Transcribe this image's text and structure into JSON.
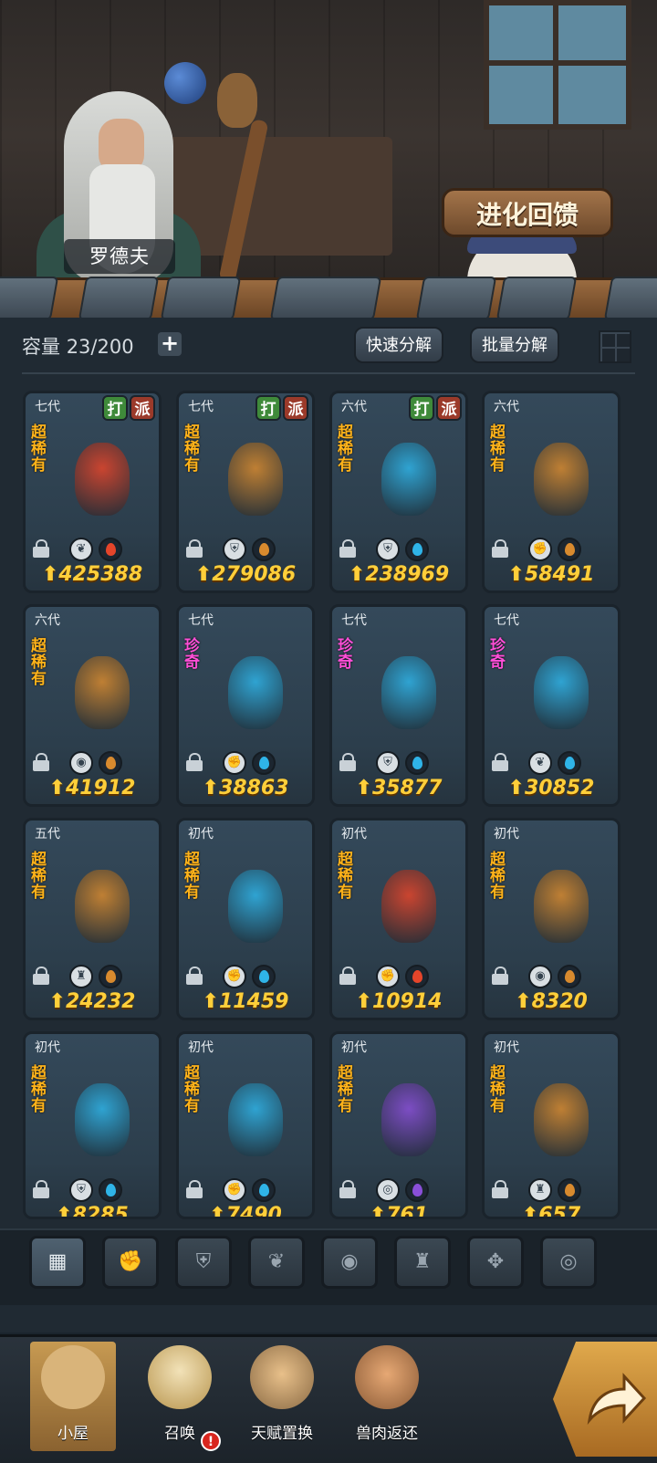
{
  "npc": {
    "name": "罗德夫"
  },
  "header": {
    "evolve_feedback": "进化回馈"
  },
  "toolbar": {
    "capacity_label": "容量",
    "capacity_value": "23/200",
    "plus": "+",
    "quick_decompose": "快速分解",
    "batch_decompose": "批量分解"
  },
  "tags": {
    "fight": "打",
    "send": "派"
  },
  "rarity_labels": {
    "super_rare": "超稀有",
    "rare": "珍奇"
  },
  "cards": [
    {
      "gen": "七代",
      "rarity": "超稀有",
      "rarity_key": "sr",
      "power": "425388",
      "fight": true,
      "send": true,
      "cls": "plant",
      "elem": "fire"
    },
    {
      "gen": "七代",
      "rarity": "超稀有",
      "rarity_key": "sr",
      "power": "279086",
      "fight": true,
      "send": true,
      "cls": "shield",
      "elem": "earth"
    },
    {
      "gen": "六代",
      "rarity": "超稀有",
      "rarity_key": "sr",
      "power": "238969",
      "fight": true,
      "send": true,
      "cls": "shield",
      "elem": "water"
    },
    {
      "gen": "六代",
      "rarity": "超稀有",
      "rarity_key": "sr",
      "power": "58491",
      "fight": false,
      "send": false,
      "cls": "fist",
      "elem": "earth"
    },
    {
      "gen": "六代",
      "rarity": "超稀有",
      "rarity_key": "sr",
      "power": "41912",
      "fight": false,
      "send": false,
      "cls": "spirit",
      "elem": "earth"
    },
    {
      "gen": "七代",
      "rarity": "珍奇",
      "rarity_key": "rare",
      "power": "38863",
      "fight": false,
      "send": false,
      "cls": "fist",
      "elem": "water"
    },
    {
      "gen": "七代",
      "rarity": "珍奇",
      "rarity_key": "rare",
      "power": "35877",
      "fight": false,
      "send": false,
      "cls": "shield",
      "elem": "water"
    },
    {
      "gen": "七代",
      "rarity": "珍奇",
      "rarity_key": "rare",
      "power": "30852",
      "fight": false,
      "send": false,
      "cls": "plant",
      "elem": "water"
    },
    {
      "gen": "五代",
      "rarity": "超稀有",
      "rarity_key": "sr",
      "power": "24232",
      "fight": false,
      "send": false,
      "cls": "tower",
      "elem": "earth"
    },
    {
      "gen": "初代",
      "rarity": "超稀有",
      "rarity_key": "sr",
      "power": "11459",
      "fight": false,
      "send": false,
      "cls": "fist",
      "elem": "water"
    },
    {
      "gen": "初代",
      "rarity": "超稀有",
      "rarity_key": "sr",
      "power": "10914",
      "fight": false,
      "send": false,
      "cls": "fist",
      "elem": "fire"
    },
    {
      "gen": "初代",
      "rarity": "超稀有",
      "rarity_key": "sr",
      "power": "8320",
      "fight": false,
      "send": false,
      "cls": "spirit",
      "elem": "earth"
    },
    {
      "gen": "初代",
      "rarity": "超稀有",
      "rarity_key": "sr",
      "power": "8285",
      "fight": false,
      "send": false,
      "cls": "shield",
      "elem": "water"
    },
    {
      "gen": "初代",
      "rarity": "超稀有",
      "rarity_key": "sr",
      "power": "7490",
      "fight": false,
      "send": false,
      "cls": "fist",
      "elem": "water"
    },
    {
      "gen": "初代",
      "rarity": "超稀有",
      "rarity_key": "sr",
      "power": "761",
      "fight": false,
      "send": false,
      "cls": "eye",
      "elem": "dark"
    },
    {
      "gen": "初代",
      "rarity": "超稀有",
      "rarity_key": "sr",
      "power": "657",
      "fight": false,
      "send": false,
      "cls": "tower",
      "elem": "earth"
    }
  ],
  "filters": [
    "all-icon",
    "fist-icon",
    "shield-icon",
    "plant-icon",
    "spirit-icon",
    "tower-icon",
    "crosshair-icon",
    "eye-icon"
  ],
  "nav": {
    "hut": "小屋",
    "summon": "召唤",
    "talent_swap": "天赋置换",
    "meat_return": "兽肉返还",
    "alert": "!"
  },
  "colors": {
    "super_rare": "#ffb31a",
    "rare": "#ff4fd8",
    "power": "#ffcf3a",
    "fire": "#e5452a",
    "water": "#2fb4e8",
    "earth": "#d88a2e",
    "dark": "#8a4fd8"
  }
}
